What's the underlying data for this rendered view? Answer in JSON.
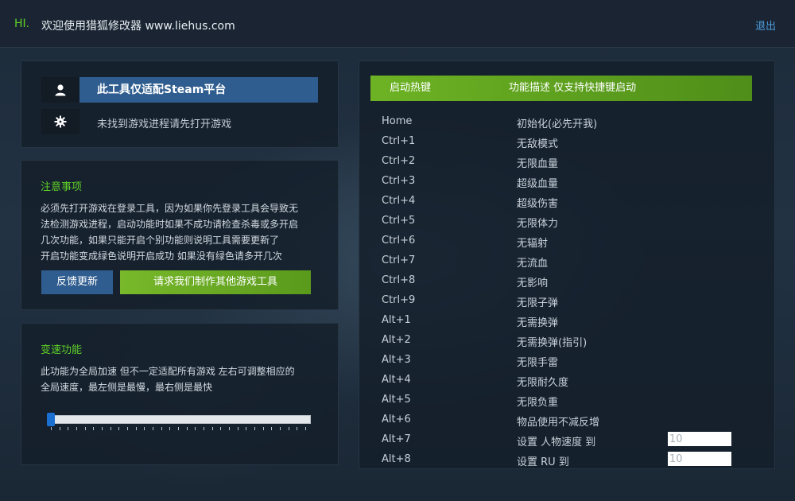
{
  "header": {
    "greeting": "HI.",
    "welcome": "欢迎使用猎狐修改器 www.liehus.com",
    "logout": "退出"
  },
  "status": {
    "platform_label": "此工具仅适配Steam平台",
    "process_label": "未找到游戏进程请先打开游戏",
    "user_icon": "user-icon",
    "status_icon": "gear-icon"
  },
  "notice": {
    "title": "注意事项",
    "lines": [
      "必须先打开游戏在登录工具，因为如果你先登录工具会导致无",
      "法检测游戏进程，启动功能时如果不成功请检查杀毒或多开启",
      "几次功能，如果只能开启个别功能则说明工具需要更新了",
      "开启功能变成绿色说明开启成功 如果没有绿色请多开几次"
    ],
    "feedback_button": "反馈更新",
    "request_button": "请求我们制作其他游戏工具"
  },
  "speed": {
    "title": "变速功能",
    "lines": [
      "此功能为全局加速 但不一定适配所有游戏 左右可调整相应的",
      "全局速度，最左侧是最慢，最右侧是最快"
    ],
    "slider_value_fraction": 0.0
  },
  "hotkeys": {
    "header_key": "启动热键",
    "header_desc": "功能描述 仅支持快捷键启动",
    "rows": [
      {
        "key": "Home",
        "desc": "初始化(必先开我)"
      },
      {
        "key": "Ctrl+1",
        "desc": "无敌模式"
      },
      {
        "key": "Ctrl+2",
        "desc": "无限血量"
      },
      {
        "key": "Ctrl+3",
        "desc": "超级血量"
      },
      {
        "key": "Ctrl+4",
        "desc": "超级伤害"
      },
      {
        "key": "Ctrl+5",
        "desc": "无限体力"
      },
      {
        "key": "Ctrl+6",
        "desc": "无辐射"
      },
      {
        "key": "Ctrl+7",
        "desc": "无流血"
      },
      {
        "key": "Ctrl+8",
        "desc": "无影响"
      },
      {
        "key": "Ctrl+9",
        "desc": "无限子弹"
      },
      {
        "key": "Alt+1",
        "desc": "无需换弹"
      },
      {
        "key": "Alt+2",
        "desc": "无需换弹(指引)"
      },
      {
        "key": "Alt+3",
        "desc": "无限手雷"
      },
      {
        "key": "Alt+4",
        "desc": "无限耐久度"
      },
      {
        "key": "Alt+5",
        "desc": "无限负重"
      },
      {
        "key": "Alt+6",
        "desc": "物品使用不减反增"
      },
      {
        "key": "Alt+7",
        "desc": "设置 人物速度 到",
        "input_value": "10"
      },
      {
        "key": "Alt+8",
        "desc": "设置 RU 到",
        "input_value": "10"
      }
    ]
  },
  "colors": {
    "accent_green": "#5fcf28",
    "accent_blue": "#2f5d8f",
    "link_blue": "#4f9fe0",
    "background": "#1b2838"
  }
}
